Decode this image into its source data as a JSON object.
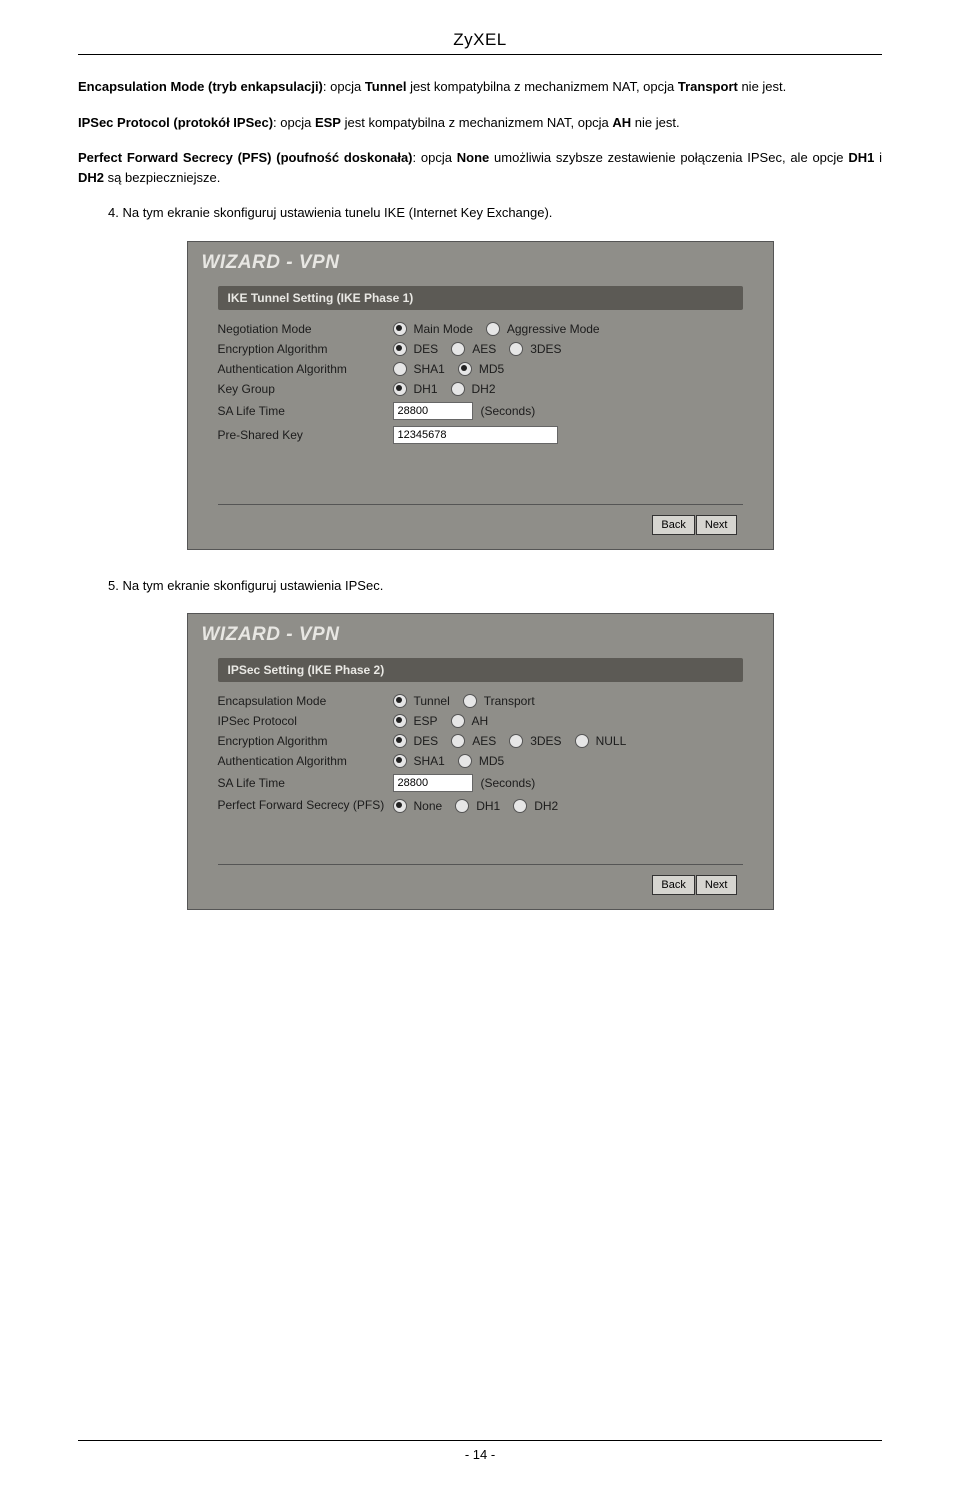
{
  "header": {
    "brand": "ZyXEL"
  },
  "paragraphs": {
    "p1_a": "Encapsulation Mode (tryb enkapsulacji)",
    "p1_b": ": opcja ",
    "p1_c": "Tunnel",
    "p1_d": " jest kompatybilna z mechanizmem NAT, opcja ",
    "p1_e": "Transport",
    "p1_f": " nie jest.",
    "p2_a": "IPSec Protocol (protokół IPSec)",
    "p2_b": ": opcja ",
    "p2_c": "ESP",
    "p2_d": " jest kompatybilna z mechanizmem NAT, opcja ",
    "p2_e": "AH",
    "p2_f": " nie jest.",
    "p3_a": "Perfect Forward Secrecy (PFS) (poufność doskonała)",
    "p3_b": ": opcja ",
    "p3_c": "None",
    "p3_d": " umożliwia szybsze zestawienie połączenia IPSec, ale opcje ",
    "p3_e": "DH1",
    "p3_f": " i ",
    "p3_g": "DH2",
    "p3_h": " są bezpieczniejsze."
  },
  "steps": {
    "s4": "Na tym ekranie skonfiguruj ustawienia tunelu IKE (Internet Key Exchange).",
    "s5": "Na tym ekranie skonfiguruj ustawienia IPSec."
  },
  "wizard1": {
    "title": "WIZARD - VPN",
    "section": "IKE Tunnel Setting (IKE Phase 1)",
    "rows": {
      "neg": {
        "label": "Negotiation Mode",
        "opt1": "Main Mode",
        "opt2": "Aggressive Mode"
      },
      "enc": {
        "label": "Encryption Algorithm",
        "opt1": "DES",
        "opt2": "AES",
        "opt3": "3DES"
      },
      "auth": {
        "label": "Authentication Algorithm",
        "opt1": "SHA1",
        "opt2": "MD5"
      },
      "kg": {
        "label": "Key Group",
        "opt1": "DH1",
        "opt2": "DH2"
      },
      "life": {
        "label": "SA Life Time",
        "value": "28800",
        "unit": "(Seconds)"
      },
      "psk": {
        "label": "Pre-Shared Key",
        "value": "12345678"
      }
    },
    "back": "Back",
    "next": "Next"
  },
  "wizard2": {
    "title": "WIZARD - VPN",
    "section": "IPSec Setting (IKE Phase 2)",
    "rows": {
      "encap": {
        "label": "Encapsulation Mode",
        "opt1": "Tunnel",
        "opt2": "Transport"
      },
      "proto": {
        "label": "IPSec Protocol",
        "opt1": "ESP",
        "opt2": "AH"
      },
      "enc": {
        "label": "Encryption Algorithm",
        "opt1": "DES",
        "opt2": "AES",
        "opt3": "3DES",
        "opt4": "NULL"
      },
      "auth": {
        "label": "Authentication Algorithm",
        "opt1": "SHA1",
        "opt2": "MD5"
      },
      "life": {
        "label": "SA Life Time",
        "value": "28800",
        "unit": "(Seconds)"
      },
      "pfs": {
        "label": "Perfect Forward Secrecy (PFS)",
        "opt1": "None",
        "opt2": "DH1",
        "opt3": "DH2"
      }
    },
    "back": "Back",
    "next": "Next"
  },
  "footer": {
    "page": "- 14 -"
  }
}
